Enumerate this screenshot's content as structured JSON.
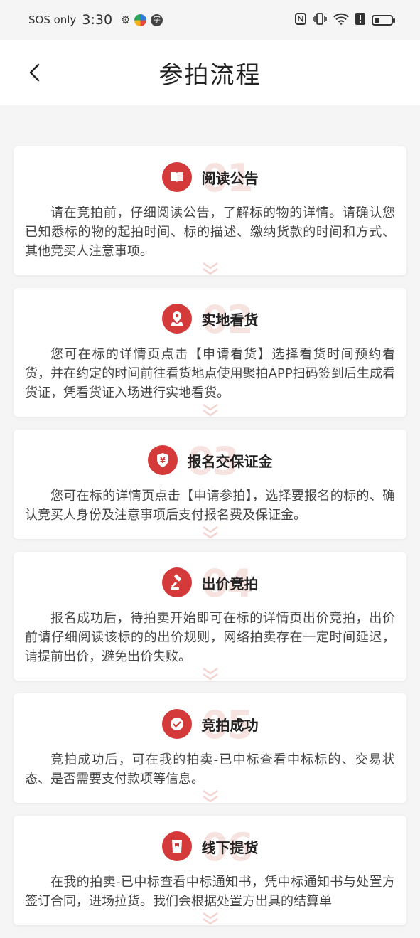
{
  "status_bar": {
    "carrier": "SOS only",
    "time": "3:30",
    "battery_level": 0.3
  },
  "nav": {
    "title": "参拍流程"
  },
  "accent_color": "#d53a3a",
  "steps": [
    {
      "number": "01",
      "title": "阅读公告",
      "icon": "book-icon",
      "text": "请在竞拍前，仔细阅读公告，了解标的物的详情。请确认您已知悉标的物的起拍时间、标的描述、缴纳货款的时间和方式、其他竞买人注意事项。"
    },
    {
      "number": "02",
      "title": "实地看货",
      "icon": "location-icon",
      "text": "您可在标的详情页点击【申请看货】选择看货时间预约看货，并在约定的时间前往看货地点使用聚拍APP扫码签到后生成看货证，凭看货证入场进行实地看货。"
    },
    {
      "number": "03",
      "title": "报名交保证金",
      "icon": "yuan-shield-icon",
      "text": "您可在标的详情页点击【申请参拍】，选择要报名的标的、确认竞买人身份及注意事项后支付报名费及保证金。"
    },
    {
      "number": "04",
      "title": "出价竞拍",
      "icon": "gavel-icon",
      "text": "报名成功后，待拍卖开始即可在标的详情页出价竞拍，出价前请仔细阅读该标的的出价规则，网络拍卖存在一定时间延迟，请提前出价，避免出价失败。"
    },
    {
      "number": "05",
      "title": "竞拍成功",
      "icon": "check-icon",
      "text": "竞拍成功后，可在我的拍卖-已中标查看中标标的、交易状态、是否需要支付款项等信息。"
    },
    {
      "number": "06",
      "title": "线下提货",
      "icon": "pickup-icon",
      "text": "在我的拍卖-已中标查看中标通知书，凭中标通知书与处置方签订合同，进场拉货。我们会根据处置方出具的结算单"
    }
  ]
}
